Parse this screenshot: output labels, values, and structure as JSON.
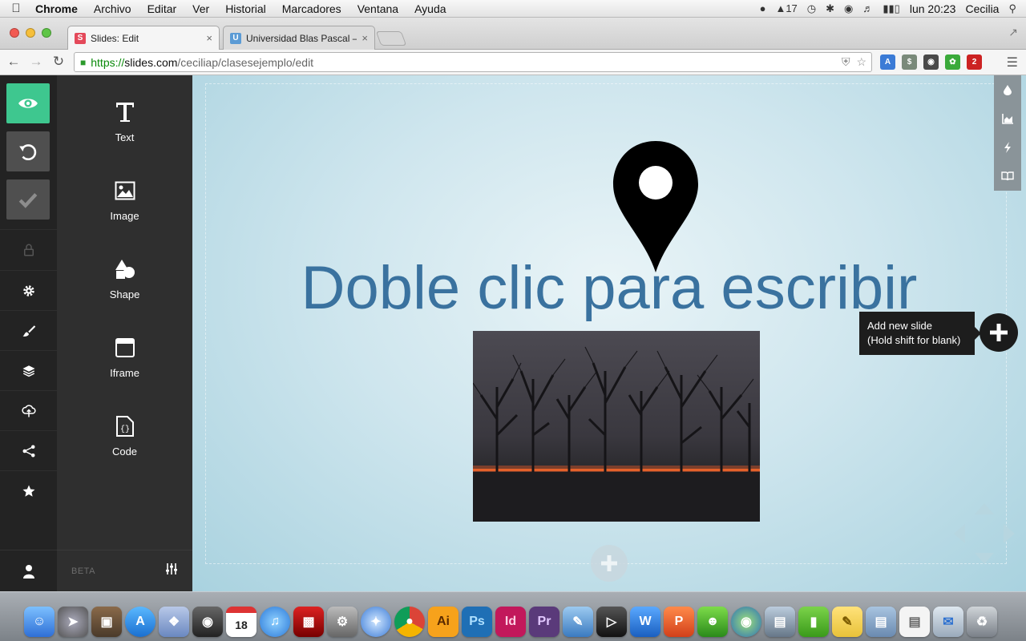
{
  "menubar": {
    "app_name": "Chrome",
    "menus": [
      "Archivo",
      "Editar",
      "Ver",
      "Historial",
      "Marcadores",
      "Ventana",
      "Ayuda"
    ],
    "status": {
      "adobe_count": "17",
      "clock": "lun 20:23",
      "user": "Cecilia"
    }
  },
  "browser": {
    "tabs": [
      {
        "title": "Slides: Edit",
        "favicon": "S",
        "favicon_color": "#e4495a",
        "active": true
      },
      {
        "title": "Universidad Blas Pascal – C",
        "favicon": "U",
        "favicon_color": "#5b9bd5",
        "active": false
      }
    ],
    "url": {
      "scheme": "https://",
      "host": "slides.com",
      "path": "/ceciliap/clasesejemplo/edit"
    },
    "extension_badge": "2"
  },
  "editor": {
    "tools": [
      {
        "label": "Text",
        "icon": "text-icon"
      },
      {
        "label": "Image",
        "icon": "image-icon"
      },
      {
        "label": "Shape",
        "icon": "shape-icon"
      },
      {
        "label": "Iframe",
        "icon": "iframe-icon"
      },
      {
        "label": "Code",
        "icon": "code-icon"
      }
    ],
    "beta_label": "BETA",
    "slide": {
      "title": "Doble clic para escribir"
    },
    "add_slide_tooltip": {
      "line1": "Add new slide",
      "line2": "(Hold shift for blank)"
    },
    "colors": {
      "accent": "#3ec78f",
      "title": "#3a729f",
      "rail": "#232323",
      "panel": "#2f2f2f"
    }
  },
  "dock": {
    "calendar_day": "18",
    "apps": [
      "finder-icon",
      "launchpad-icon",
      "photo-icon",
      "appstore-icon",
      "preview-icon",
      "facetime-icon",
      "calendar-icon",
      "itunes-icon",
      "photobooth-icon",
      "system-prefs-icon",
      "safari-icon",
      "chrome-icon",
      "illustrator-icon",
      "photoshop-icon",
      "indesign-icon",
      "premiere-icon",
      "utility-icon",
      "fcp-icon",
      "word-icon",
      "powerpoint-icon",
      "messenger-icon",
      "network-icon",
      "screenshot-icon",
      "evernote-icon",
      "stickies-icon",
      "folder-icon",
      "document-icon",
      "mail-icon",
      "trash-icon"
    ]
  }
}
